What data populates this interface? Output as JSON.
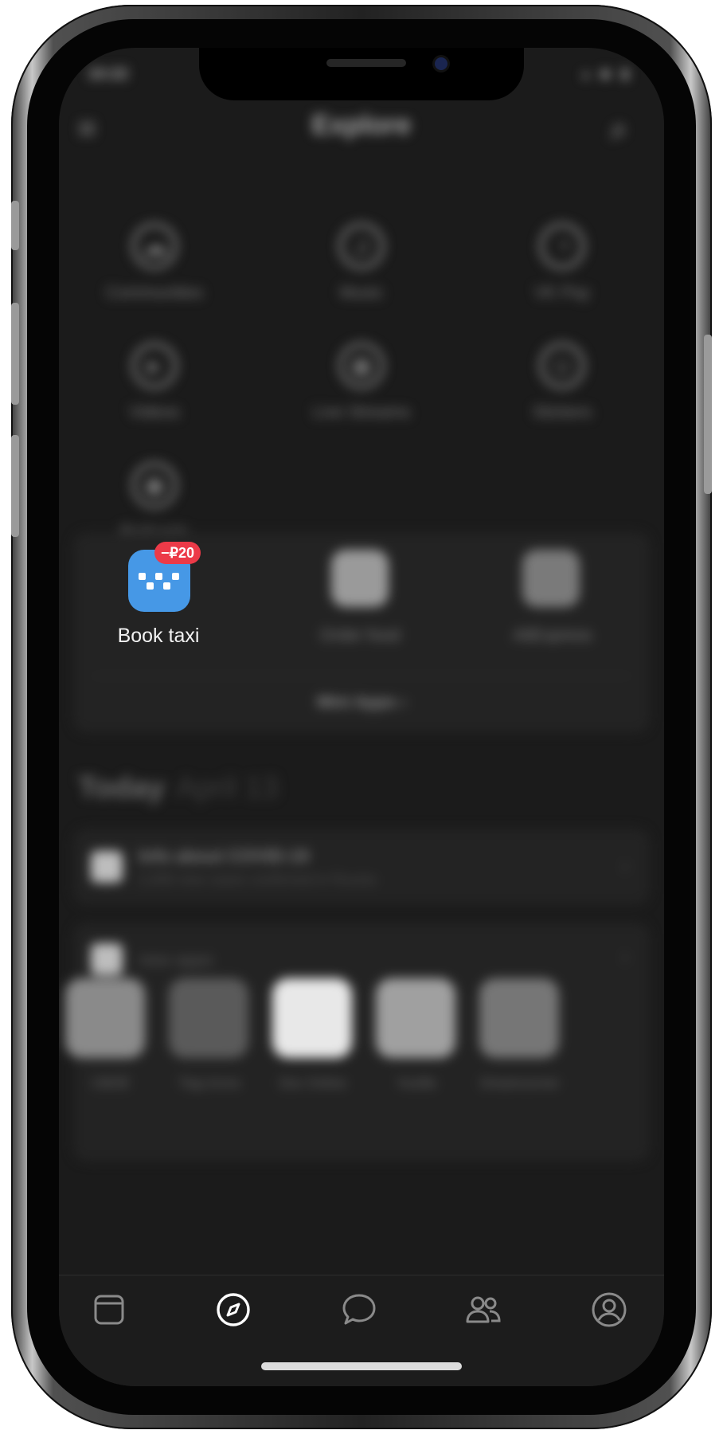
{
  "status_bar": {
    "time": "10:22",
    "icons": "▴ ◆ ▮"
  },
  "header": {
    "title": "Explore"
  },
  "services": [
    {
      "label": "Communities",
      "icon": "communities-icon"
    },
    {
      "label": "Music",
      "icon": "music-icon"
    },
    {
      "label": "VK Pay",
      "icon": "vk-pay-icon"
    },
    {
      "label": "Videos",
      "icon": "videos-icon"
    },
    {
      "label": "Live Streams",
      "icon": "live-streams-icon"
    },
    {
      "label": "Stickers",
      "icon": "stickers-icon"
    },
    {
      "label": "Podcasts",
      "icon": "podcasts-icon"
    }
  ],
  "mini_apps": {
    "items": [
      {
        "label": "Book taxi",
        "badge": "−₽20",
        "color": "#4698e6"
      },
      {
        "label": "Order food",
        "color": "#9a9a9a"
      },
      {
        "label": "AliExpress",
        "color": "#7a7a7a"
      }
    ],
    "more_label": "Mini Apps ›"
  },
  "today": {
    "label": "Today",
    "date": "April 13"
  },
  "info_card": {
    "title": "Info about COVID-19",
    "subtitle": "2,000 new cases confirmed in Russia"
  },
  "new_apps_card": {
    "title": "new apps",
    "apps": [
      {
        "label": "СВОЁ"
      },
      {
        "label": "Tiqq Алло"
      },
      {
        "label": "Doc Online"
      },
      {
        "label": "Youfile"
      },
      {
        "label": "Dreamcorner"
      }
    ]
  },
  "tabbar": {
    "tabs": [
      {
        "name": "news-tab",
        "icon": "feed-icon"
      },
      {
        "name": "explore-tab",
        "icon": "compass-icon",
        "active": true
      },
      {
        "name": "messages-tab",
        "icon": "chat-bubble-icon"
      },
      {
        "name": "friends-tab",
        "icon": "friends-icon"
      },
      {
        "name": "profile-tab",
        "icon": "profile-icon"
      }
    ]
  },
  "colors": {
    "accent": "#4698e6",
    "badge": "#ec3a48",
    "screen_bg": "#1b1b1b"
  }
}
